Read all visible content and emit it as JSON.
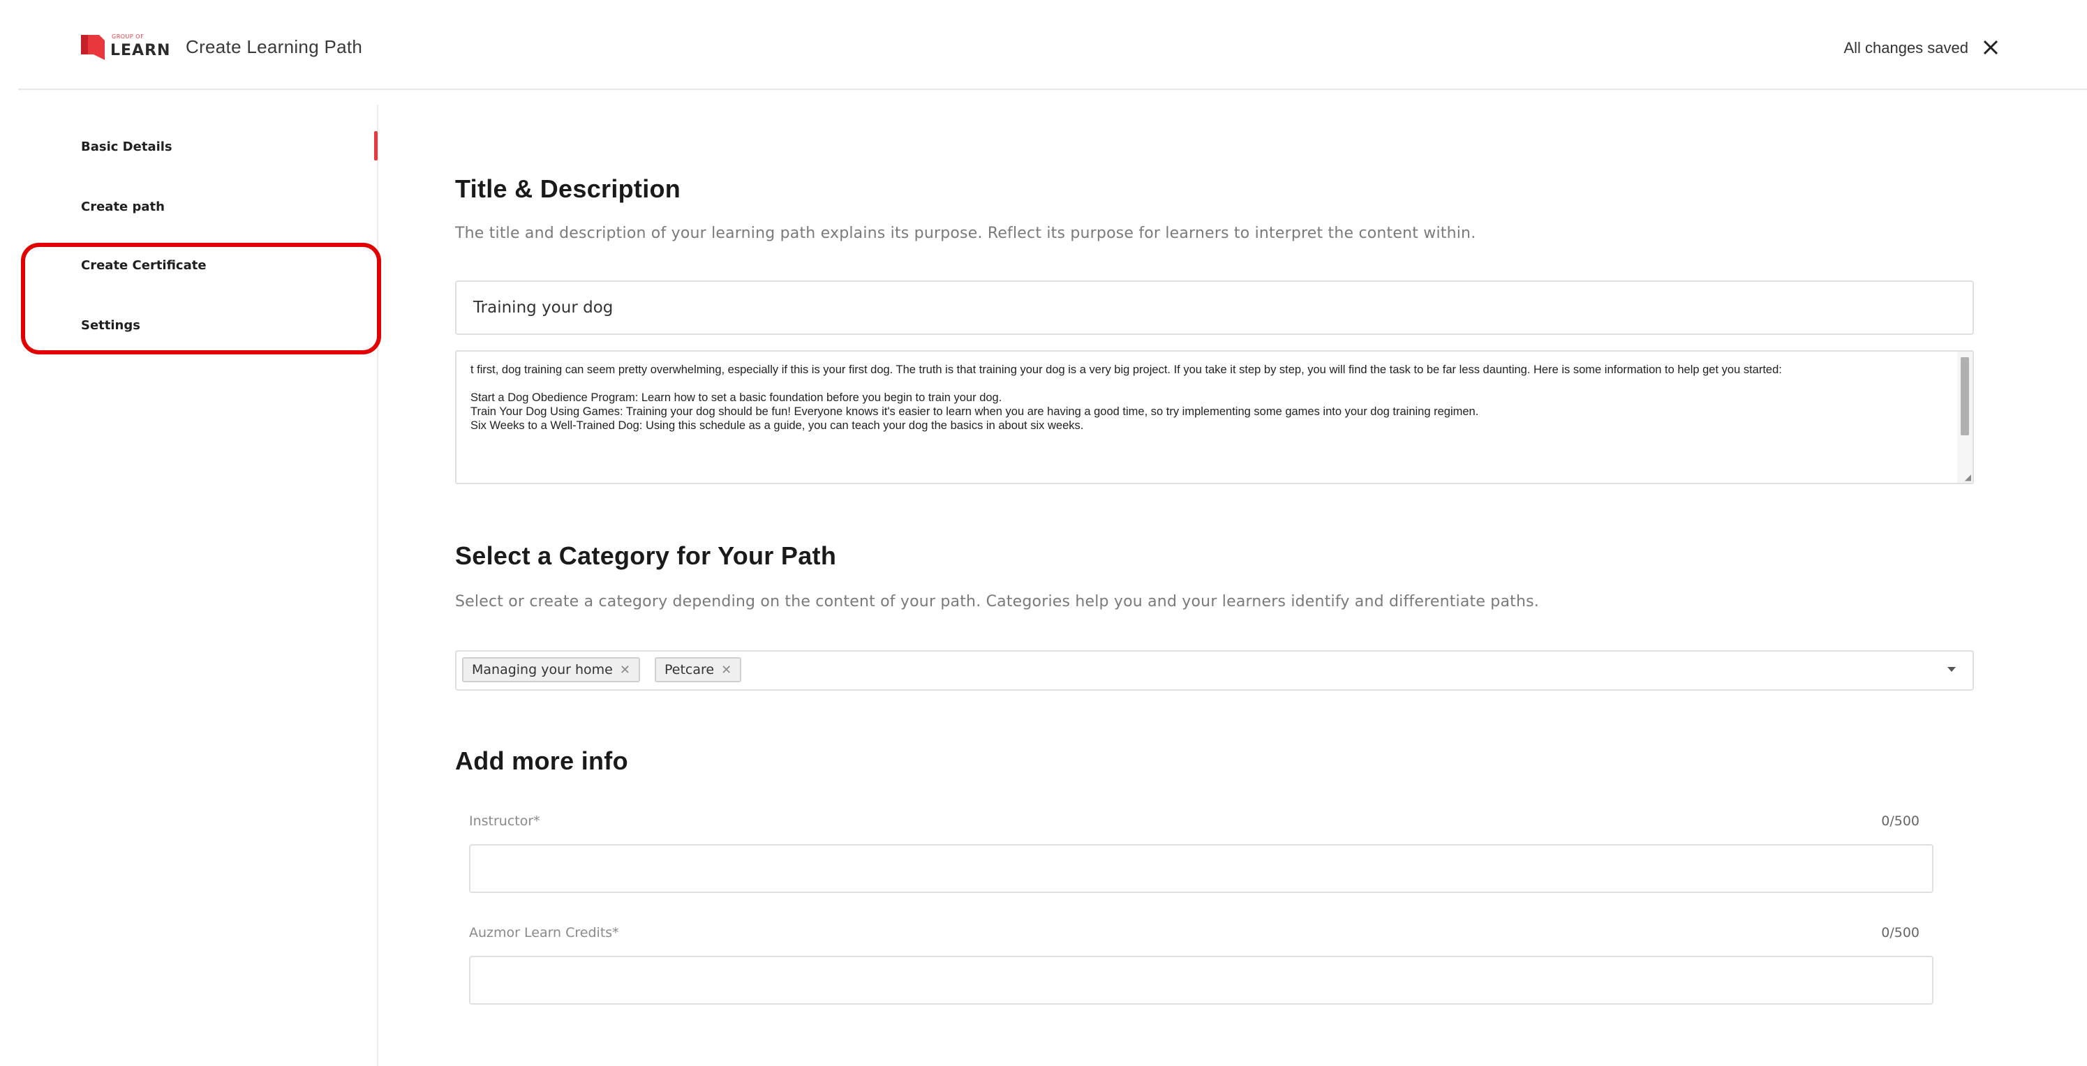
{
  "header": {
    "logo_small": "GROUP OF",
    "logo_word": "LEARN",
    "title": "Create Learning Path",
    "save_status": "All changes saved"
  },
  "sidebar": {
    "items": [
      {
        "label": "Basic Details"
      },
      {
        "label": "Create path"
      },
      {
        "label": "Create Certificate"
      },
      {
        "label": "Settings"
      }
    ]
  },
  "title_section": {
    "heading": "Title & Description",
    "description": "The title and description of your learning path explains its purpose. Reflect its purpose for learners to interpret the content within.",
    "title_value": "Training your dog",
    "body_lines": [
      "t first, dog training can seem pretty overwhelming, especially if this is your first dog. The truth is that training your dog is a very big project. If you take it step by step, you will find the task to be far less daunting. Here is some information to help get you started:",
      "Start a Dog Obedience Program: Learn how to set a basic foundation before you begin to train your dog.",
      "Train Your Dog Using Games: Training your dog should be fun! Everyone knows it's easier to learn when you are having a good time, so try implementing some games into your dog training regimen.",
      "Six Weeks to a Well-Trained Dog: Using this schedule as a guide, you can teach your dog the basics in about six weeks."
    ]
  },
  "category_section": {
    "heading": "Select a Category for Your Path",
    "description": "Select or create a category depending on the content of your path. Categories help you and your learners identify and differentiate paths.",
    "chips": [
      "Managing your home",
      "Petcare"
    ]
  },
  "more_info": {
    "heading": "Add more info",
    "fields": [
      {
        "label": "Instructor*",
        "counter": "0/500",
        "value": ""
      },
      {
        "label": "Auzmor Learn Credits*",
        "counter": "0/500",
        "value": ""
      }
    ]
  },
  "colors": {
    "brand": "#e8383d",
    "highlight": "#e30000"
  }
}
